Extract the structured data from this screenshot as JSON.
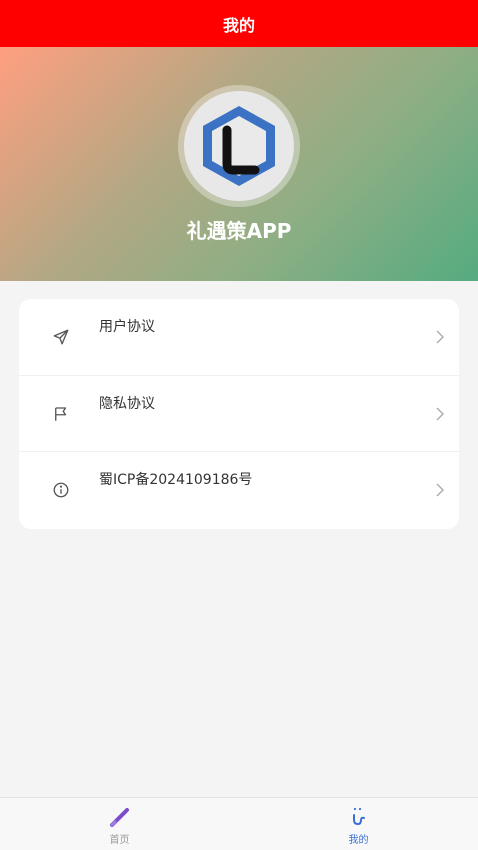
{
  "topbar": {
    "title": "我的"
  },
  "profile": {
    "app_name": "礼遇策APP",
    "logo_icon": "hexagon-L-logo-icon"
  },
  "menu": {
    "items": [
      {
        "label": "用户协议",
        "icon": "send-icon"
      },
      {
        "label": "隐私协议",
        "icon": "flag-icon"
      },
      {
        "label": "蜀ICP备2024109186号",
        "icon": "info-icon"
      }
    ]
  },
  "tabbar": {
    "tabs": [
      {
        "label": "首页",
        "icon": "feather-icon",
        "active": false
      },
      {
        "label": "我的",
        "icon": "smile-icon",
        "active": true
      }
    ]
  },
  "colors": {
    "topbar_bg": "#ff0000",
    "active_tab": "#3b6fd6",
    "logo_blue": "#3b72c4"
  }
}
